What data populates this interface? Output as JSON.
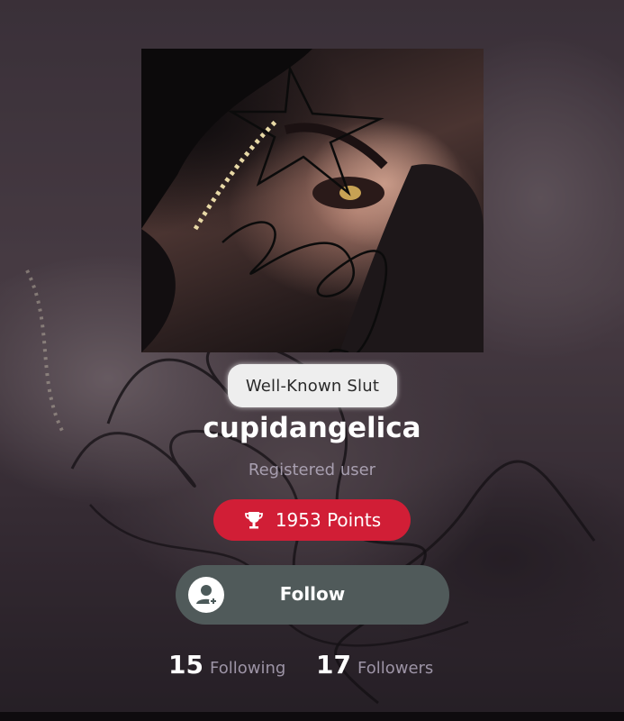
{
  "profile": {
    "title_badge": "Well-Known Slut",
    "username": "cupidangelica",
    "role": "Registered user",
    "points_label": "1953 Points",
    "follow_label": "Follow",
    "following_count": "15",
    "following_label": "Following",
    "followers_count": "17",
    "followers_label": "Followers"
  },
  "colors": {
    "points_pill": "#d11e36",
    "follow_button": "#505a5a",
    "username_text": "#ffffff",
    "muted_text": "#a89fb0"
  },
  "icons": {
    "points": "trophy-icon",
    "follow": "add-user-icon"
  }
}
